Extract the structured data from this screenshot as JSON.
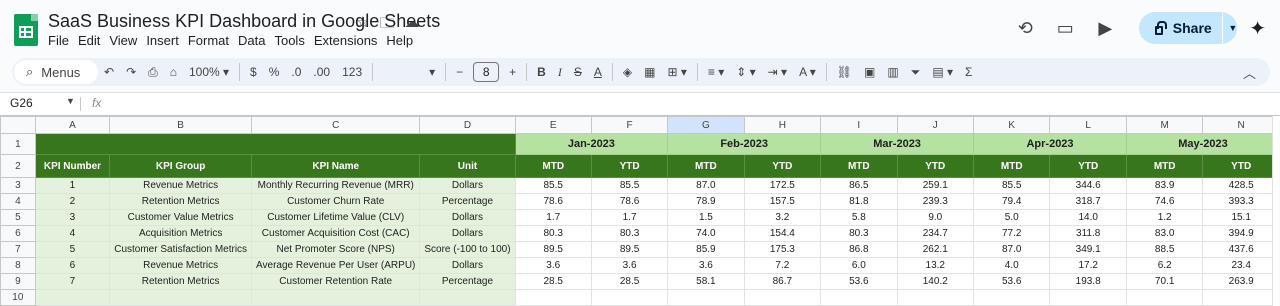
{
  "app": {
    "title": "SaaS Business KPI Dashboard in Google Sheets",
    "menu": [
      "File",
      "Edit",
      "View",
      "Insert",
      "Format",
      "Data",
      "Tools",
      "Extensions",
      "Help"
    ],
    "share_label": "Share"
  },
  "toolbar": {
    "menus_label": "Menus",
    "zoom": "100%",
    "currency": "$",
    "percent": "%",
    "dec_decrease": ".0",
    "dec_increase": ".00",
    "number_format": "123",
    "font_size": "8",
    "minus": "−",
    "plus": "+",
    "bold": "B",
    "italic": "I",
    "strike": "S",
    "text_color": "A",
    "sigma": "Σ"
  },
  "formula_bar": {
    "name_box": "G26",
    "fx": "fx"
  },
  "sheet": {
    "column_letters": [
      "A",
      "B",
      "C",
      "D",
      "E",
      "F",
      "G",
      "H",
      "I",
      "J",
      "K",
      "L",
      "M",
      "N"
    ],
    "row_numbers": [
      "1",
      "2",
      "3",
      "4",
      "5",
      "6",
      "7",
      "8",
      "9",
      "10"
    ],
    "months": [
      "Jan-2023",
      "Feb-2023",
      "Mar-2023",
      "Apr-2023",
      "May-2023"
    ],
    "header": {
      "kpi_number": "KPI Number",
      "kpi_group": "KPI Group",
      "kpi_name": "KPI Name",
      "unit": "Unit",
      "mtd": "MTD",
      "ytd": "YTD"
    },
    "rows": [
      {
        "num": "1",
        "group": "Revenue Metrics",
        "name": "Monthly Recurring Revenue (MRR)",
        "unit": "Dollars",
        "values": [
          "85.5",
          "85.5",
          "87.0",
          "172.5",
          "86.5",
          "259.1",
          "85.5",
          "344.6",
          "83.9",
          "428.5"
        ]
      },
      {
        "num": "2",
        "group": "Retention Metrics",
        "name": "Customer Churn Rate",
        "unit": "Percentage",
        "values": [
          "78.6",
          "78.6",
          "78.9",
          "157.5",
          "81.8",
          "239.3",
          "79.4",
          "318.7",
          "74.6",
          "393.3"
        ]
      },
      {
        "num": "3",
        "group": "Customer Value Metrics",
        "name": "Customer Lifetime Value (CLV)",
        "unit": "Dollars",
        "values": [
          "1.7",
          "1.7",
          "1.5",
          "3.2",
          "5.8",
          "9.0",
          "5.0",
          "14.0",
          "1.2",
          "15.1"
        ]
      },
      {
        "num": "4",
        "group": "Acquisition Metrics",
        "name": "Customer Acquisition Cost (CAC)",
        "unit": "Dollars",
        "values": [
          "80.3",
          "80.3",
          "74.0",
          "154.4",
          "80.3",
          "234.7",
          "77.2",
          "311.8",
          "83.0",
          "394.9"
        ]
      },
      {
        "num": "5",
        "group": "Customer Satisfaction Metrics",
        "name": "Net Promoter Score (NPS)",
        "unit": "Score (-100 to 100)",
        "values": [
          "89.5",
          "89.5",
          "85.9",
          "175.3",
          "86.8",
          "262.1",
          "87.0",
          "349.1",
          "88.5",
          "437.6"
        ]
      },
      {
        "num": "6",
        "group": "Revenue Metrics",
        "name": "Average Revenue Per User (ARPU)",
        "unit": "Dollars",
        "values": [
          "3.6",
          "3.6",
          "3.6",
          "7.2",
          "6.0",
          "13.2",
          "4.0",
          "17.2",
          "6.2",
          "23.4"
        ]
      },
      {
        "num": "7",
        "group": "Retention Metrics",
        "name": "Customer Retention Rate",
        "unit": "Percentage",
        "values": [
          "28.5",
          "28.5",
          "58.1",
          "86.7",
          "53.6",
          "140.2",
          "53.6",
          "193.8",
          "70.1",
          "263.9"
        ]
      }
    ]
  }
}
